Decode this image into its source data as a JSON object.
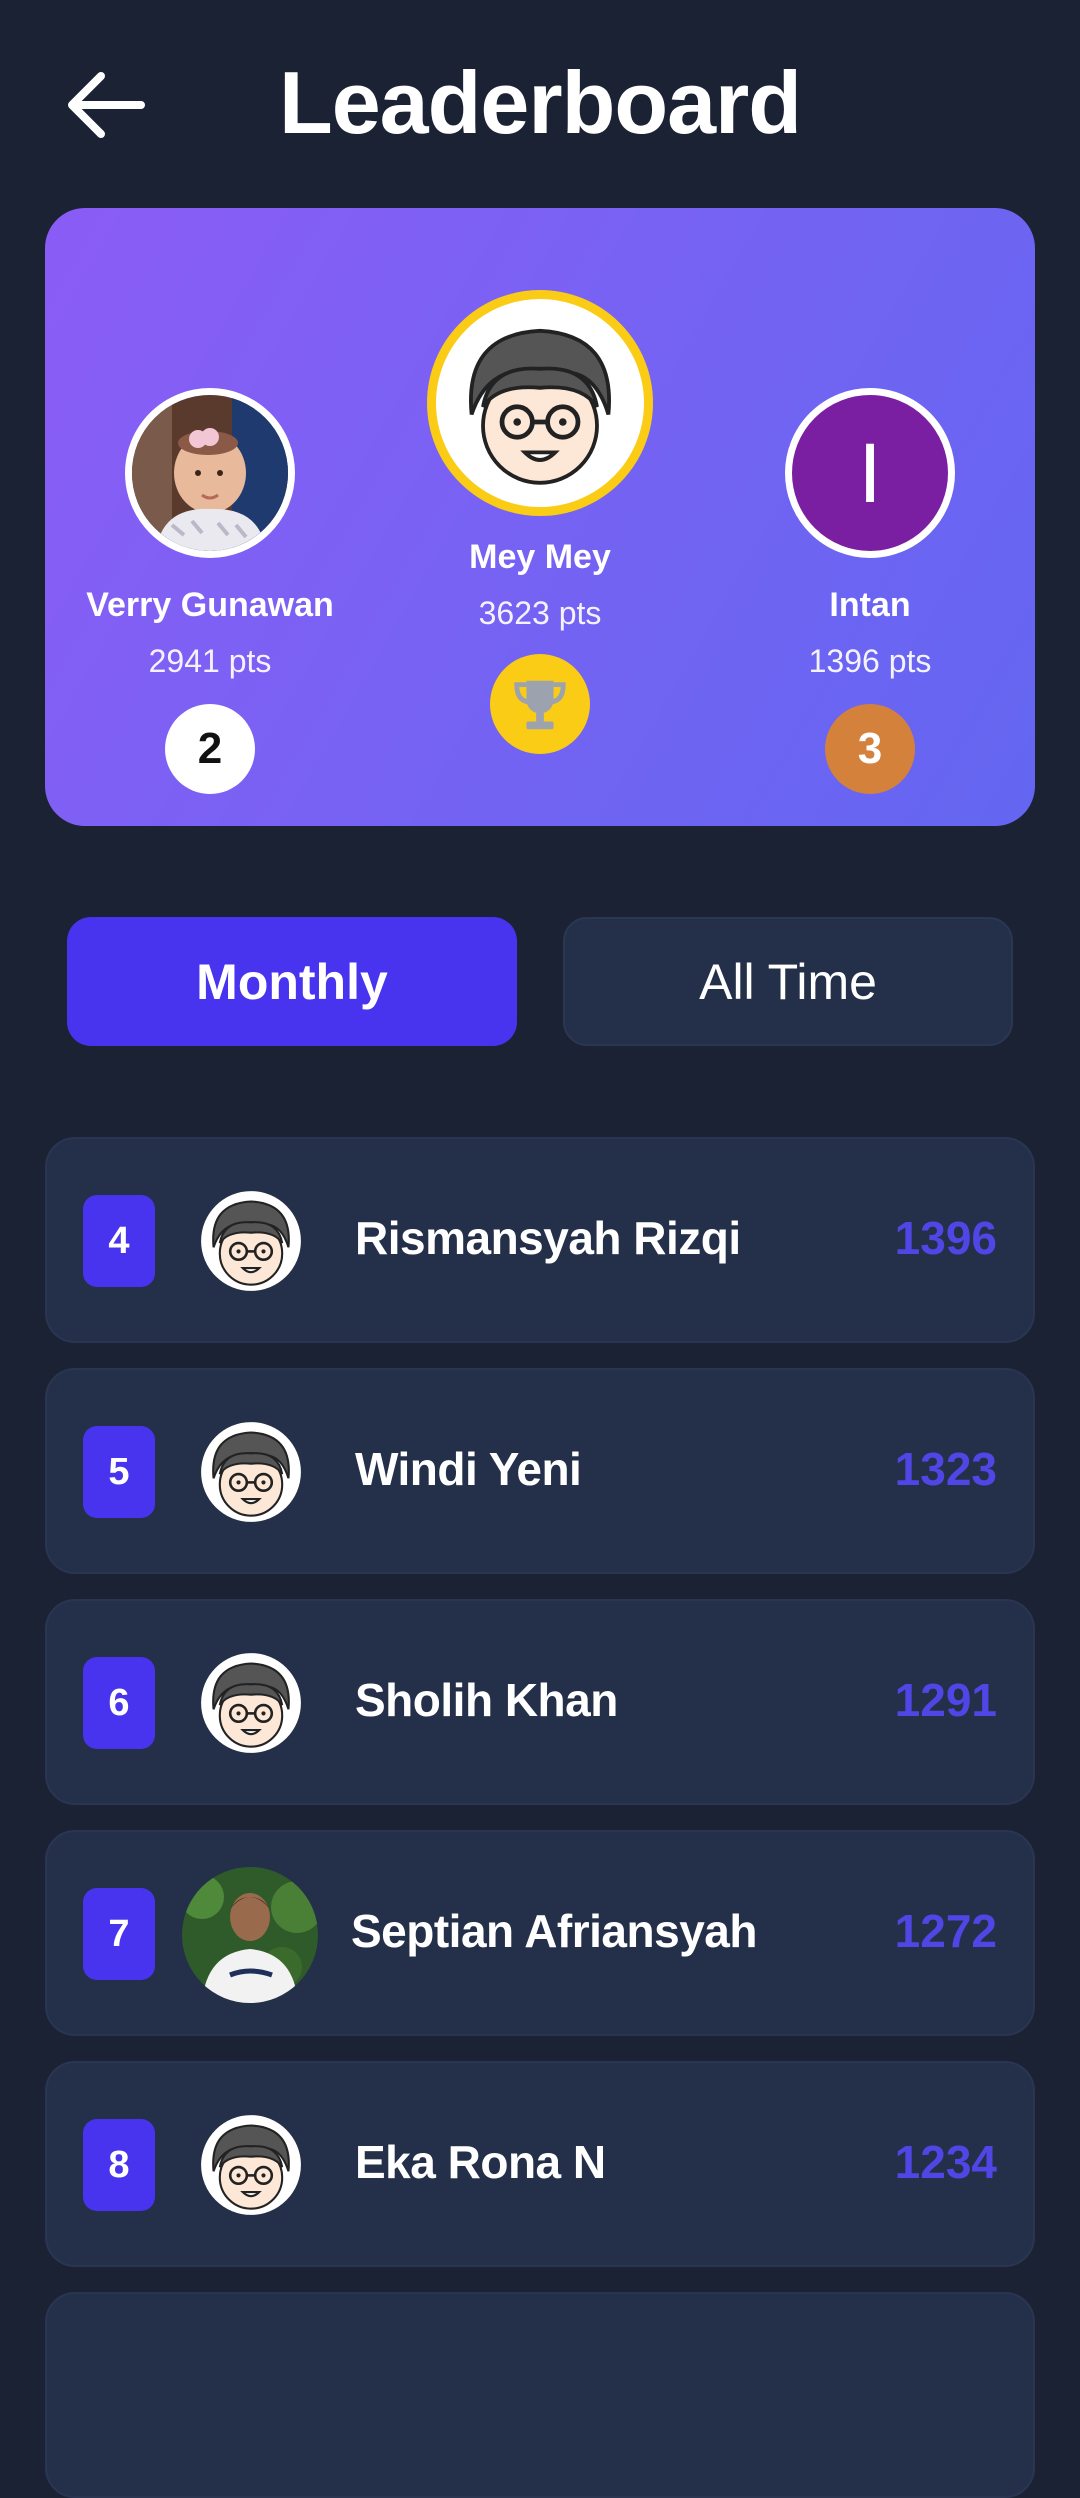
{
  "header": {
    "title": "Leaderboard",
    "back_icon": "arrow-left-icon"
  },
  "podium": {
    "second": {
      "name": "Verry Gunawan",
      "points": "2941 pts",
      "rank": "2"
    },
    "first": {
      "name": "Mey Mey",
      "points": "3623 pts",
      "badge_icon": "trophy-icon"
    },
    "third": {
      "name": "Intan",
      "points": "1396 pts",
      "rank": "3",
      "initial": "I"
    }
  },
  "tabs": {
    "monthly": "Monthly",
    "all_time": "All Time"
  },
  "list": [
    {
      "rank": "4",
      "name": "Rismansyah Rizqi",
      "score": "1396"
    },
    {
      "rank": "5",
      "name": "Windi Yeni",
      "score": "1323"
    },
    {
      "rank": "6",
      "name": "Sholih Khan",
      "score": "1291"
    },
    {
      "rank": "7",
      "name": "Septian Afriansyah",
      "score": "1272"
    },
    {
      "rank": "8",
      "name": "Eka Rona N",
      "score": "1234"
    }
  ],
  "colors": {
    "background": "#1b2234",
    "card": "#243049",
    "accent": "#4834ef",
    "gold": "#facc15",
    "bronze": "#d4813c",
    "score": "#4f46e5"
  }
}
